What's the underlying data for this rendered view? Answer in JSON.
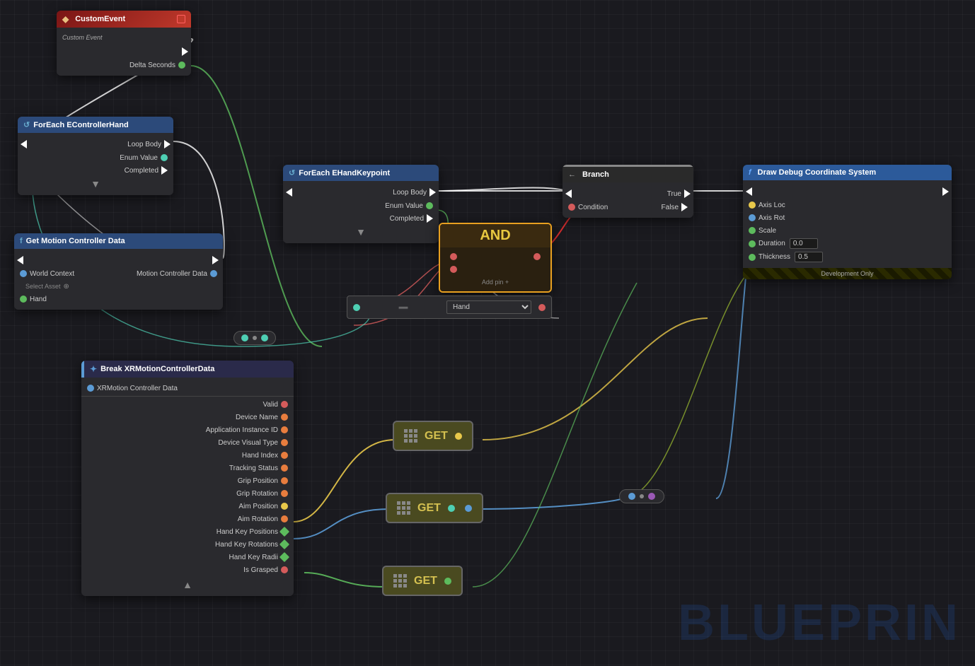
{
  "watermark": "BLUEPRIN",
  "nodes": {
    "customEvent": {
      "title": "CustomEvent",
      "subtitle": "Custom Event",
      "exec_out": "",
      "delta_seconds": "Delta Seconds"
    },
    "forEachHand": {
      "title": "ForEach EControllerHand",
      "loop_body": "Loop Body",
      "enum_value": "Enum Value",
      "completed": "Completed"
    },
    "getMotion": {
      "title": "Get Motion Controller Data",
      "world_context": "World Context",
      "select_asset": "Select Asset",
      "motion_controller_data": "Motion Controller Data",
      "hand": "Hand"
    },
    "breakXR": {
      "title": "Break XRMotionControllerData",
      "xr_motion": "XRMotion Controller Data",
      "valid": "Valid",
      "device_name": "Device Name",
      "app_instance_id": "Application Instance ID",
      "device_visual_type": "Device Visual Type",
      "hand_index": "Hand Index",
      "tracking_status": "Tracking Status",
      "grip_position": "Grip Position",
      "grip_rotation": "Grip Rotation",
      "aim_position": "Aim Position",
      "aim_rotation": "Aim Rotation",
      "hand_key_positions": "Hand Key Positions",
      "hand_key_rotations": "Hand Key Rotations",
      "hand_key_radii": "Hand Key Radii",
      "is_grasped": "Is Grasped"
    },
    "forEachKeypoint": {
      "title": "ForEach EHandKeypoint",
      "loop_body": "Loop Body",
      "enum_value": "Enum Value",
      "completed": "Completed"
    },
    "andNode": {
      "label": "AND",
      "add_pin": "Add pin +"
    },
    "branch": {
      "title": "Branch",
      "condition": "Condition",
      "true_label": "True",
      "false_label": "False"
    },
    "drawDebug": {
      "title": "Draw Debug Coordinate System",
      "axis_loc": "Axis Loc",
      "axis_rot": "Axis Rot",
      "scale": "Scale",
      "duration": "Duration",
      "duration_value": "0.0",
      "thickness": "Thickness",
      "thickness_value": "0.5",
      "dev_only": "Development Only"
    },
    "handDropdown": {
      "placeholder": "Hand",
      "value": "Hand"
    }
  }
}
